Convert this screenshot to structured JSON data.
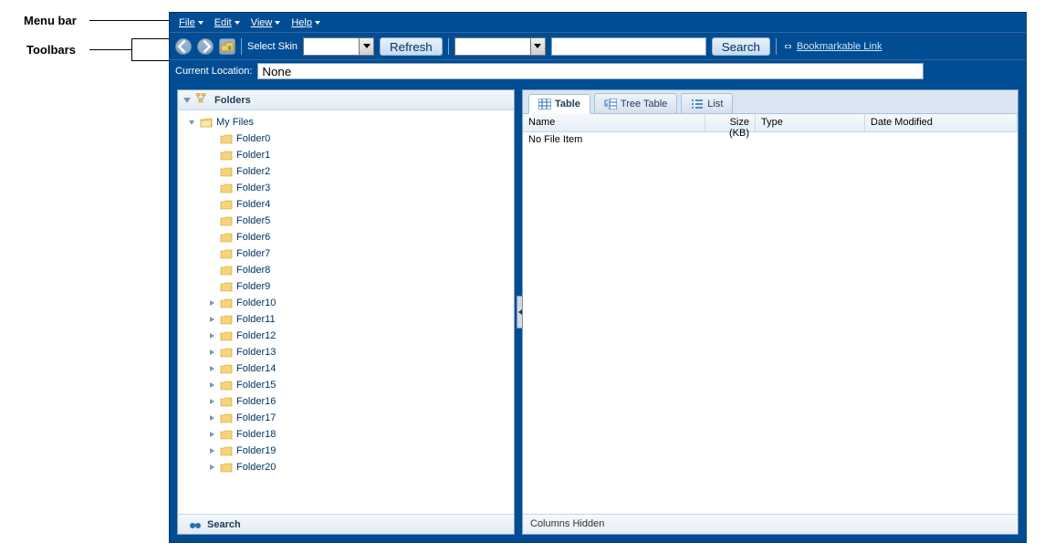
{
  "annotations": {
    "menubar_label": "Menu bar",
    "toolbars_label": "Toolbars"
  },
  "menubar": {
    "items": [
      "File",
      "Edit",
      "View",
      "Help"
    ]
  },
  "toolbar": {
    "select_skin_label": "Select Skin",
    "refresh_label": "Refresh",
    "search_label": "Search",
    "bookmark_label": "Bookmarkable Link"
  },
  "location": {
    "label": "Current Location:",
    "value": "None"
  },
  "sidebar": {
    "folders_title": "Folders",
    "search_title": "Search",
    "root_label": "My Files",
    "children": [
      {
        "label": "Folder0",
        "expandable": false
      },
      {
        "label": "Folder1",
        "expandable": false
      },
      {
        "label": "Folder2",
        "expandable": false
      },
      {
        "label": "Folder3",
        "expandable": false
      },
      {
        "label": "Folder4",
        "expandable": false
      },
      {
        "label": "Folder5",
        "expandable": false
      },
      {
        "label": "Folder6",
        "expandable": false
      },
      {
        "label": "Folder7",
        "expandable": false
      },
      {
        "label": "Folder8",
        "expandable": false
      },
      {
        "label": "Folder9",
        "expandable": false
      },
      {
        "label": "Folder10",
        "expandable": true
      },
      {
        "label": "Folder11",
        "expandable": true
      },
      {
        "label": "Folder12",
        "expandable": true
      },
      {
        "label": "Folder13",
        "expandable": true
      },
      {
        "label": "Folder14",
        "expandable": true
      },
      {
        "label": "Folder15",
        "expandable": true
      },
      {
        "label": "Folder16",
        "expandable": true
      },
      {
        "label": "Folder17",
        "expandable": true
      },
      {
        "label": "Folder18",
        "expandable": true
      },
      {
        "label": "Folder19",
        "expandable": true
      },
      {
        "label": "Folder20",
        "expandable": true
      }
    ]
  },
  "tabs": {
    "table": "Table",
    "tree_table": "Tree Table",
    "list": "List"
  },
  "table": {
    "columns": {
      "name": "Name",
      "size": "Size (KB)",
      "type": "Type",
      "date": "Date Modified"
    },
    "empty_text": "No File Item",
    "footer": "Columns Hidden"
  }
}
